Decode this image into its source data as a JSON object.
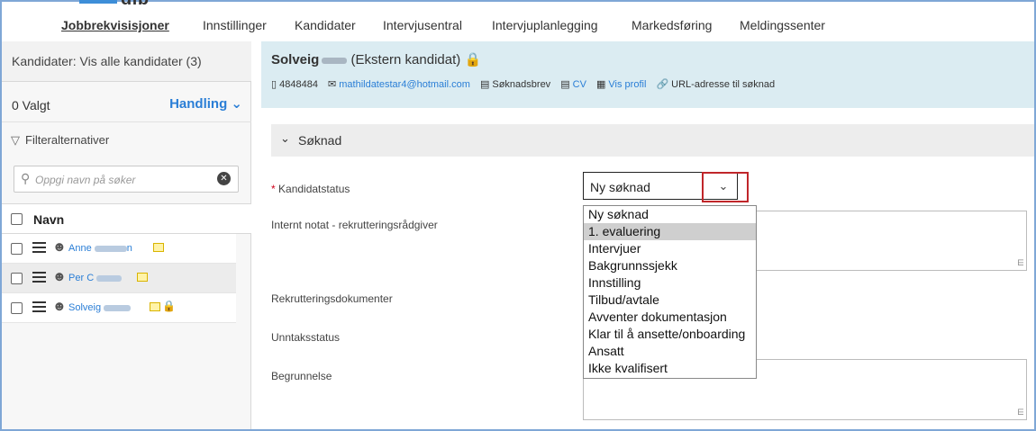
{
  "brand": {
    "partial_logo": "dfb"
  },
  "topnav": [
    {
      "label": "Jobbrekvisisjoner",
      "active": true
    },
    {
      "label": "Innstillinger",
      "active": false
    },
    {
      "label": "Kandidater",
      "active": false
    },
    {
      "label": "Intervjusentral",
      "active": false
    },
    {
      "label": "Intervjuplanlegging",
      "active": false
    },
    {
      "label": "Markedsføring",
      "active": false
    },
    {
      "label": "Meldingssenter",
      "active": false
    }
  ],
  "left": {
    "header": "Kandidater: Vis alle kandidater (3)",
    "selected": "0 Valgt",
    "action": "Handling",
    "filter": "Filteralternativer",
    "search_placeholder": "Oppgi navn på søker",
    "column_name": "Navn",
    "candidates": [
      {
        "first": "Anne",
        "last_suffix": "n"
      },
      {
        "first": "Per",
        "last_suffix": "C"
      },
      {
        "first": "Solveig",
        "last_suffix": ""
      }
    ]
  },
  "candidate": {
    "first_name": "Solveig",
    "type": "(Ekstern kandidat)",
    "phone": "4848484",
    "email": "mathildatestar4@hotmail.com",
    "cover_letter": "Søknadsbrev",
    "cv": "CV",
    "profile": "Vis profil",
    "url": "URL-adresse til søknad"
  },
  "section": {
    "title": "Søknad"
  },
  "form": {
    "status_label": "Kandidatstatus",
    "required_mark": "*",
    "note_label": "Internt notat - rekrutteringsrådgiver",
    "docs_label": "Rekrutteringsdokumenter",
    "exception_label": "Unntaksstatus",
    "reason_label": "Begrunnelse",
    "status_value": "Ny søknad",
    "status_options": [
      "Ny søknad",
      "1. evaluering",
      "Intervjuer",
      "Bakgrunnssjekk",
      "Innstilling",
      "Tilbud/avtale",
      "Avventer dokumentasjon",
      "Klar til å ansette/onboarding",
      "Ansatt",
      "Ikke kvalifisert"
    ],
    "highlighted_option_index": 1
  },
  "colors": {
    "accent": "#2a7ed6",
    "header_bg": "#dbecf2",
    "highlight_border": "#c0262a"
  }
}
